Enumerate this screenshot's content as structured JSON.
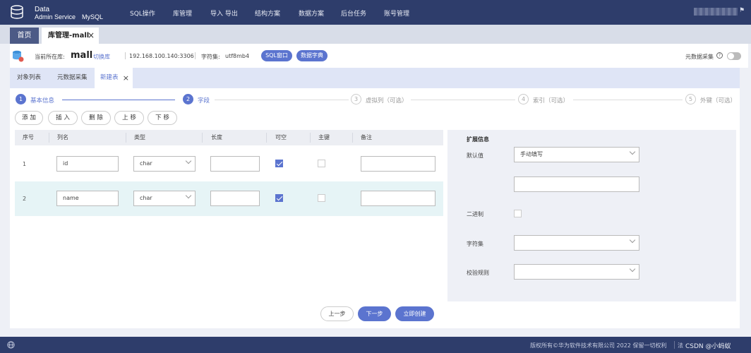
{
  "brand": {
    "line1": "Data",
    "line2": "Admin Service",
    "db": "MySQL"
  },
  "nav": [
    "SQL操作",
    "库管理",
    "导入 导出",
    "结构方案",
    "数据方案",
    "后台任务",
    "账号管理"
  ],
  "tabs": {
    "home": "首页",
    "current": "库管理-mall",
    "close": "×"
  },
  "db_bar": {
    "current_label": "当前所在库:",
    "db_name": "mall",
    "switch": "切换库",
    "host": "192.168.100.140:3306",
    "charset_label": "字符集:",
    "charset": "utf8mb4",
    "sql_window": "SQL窗口",
    "dictionary": "数据字典",
    "metadata_collect": "元数据采集",
    "metadata_enabled": false
  },
  "sub_tabs": [
    "对象列表",
    "元数据采集",
    "新建表"
  ],
  "sub_tab_close": "×",
  "steps": [
    {
      "num": "1",
      "label": "基本信息",
      "active": true
    },
    {
      "num": "2",
      "label": "字段",
      "active": true
    },
    {
      "num": "3",
      "label": "虚拟列（可选）",
      "active": false
    },
    {
      "num": "4",
      "label": "索引（可选）",
      "active": false
    },
    {
      "num": "5",
      "label": "外键（可选）",
      "active": false
    }
  ],
  "actions": [
    "添 加",
    "插 入",
    "删 除",
    "上 移",
    "下 移"
  ],
  "columns": [
    "序号",
    "列名",
    "类型",
    "长度",
    "可空",
    "主键",
    "备注"
  ],
  "rows": [
    {
      "index": "1",
      "name": "id",
      "type": "char",
      "length": "",
      "nullable": true,
      "primary": false,
      "comment": ""
    },
    {
      "index": "2",
      "name": "name",
      "type": "char",
      "length": "",
      "nullable": true,
      "primary": false,
      "comment": ""
    }
  ],
  "extension": {
    "title": "扩展信息",
    "default_label": "默认值",
    "default_value": "手动填写",
    "default_input": "",
    "binary_label": "二进制",
    "charset_label": "字符集",
    "charset_value": "",
    "collation_label": "校验规则",
    "collation_value": ""
  },
  "footer_buttons": {
    "prev": "上一步",
    "next": "下一步",
    "create": "立即创建"
  },
  "footer": {
    "copyright": "版权所有©华为软件技术有限公司 2022 保留一切权利",
    "law": "法",
    "watermark": "CSDN @小蚂蚁"
  },
  "colors": {
    "topbar": "#2e3d6b",
    "accent": "#5b74cf",
    "highlight_row": "#e6f4f6"
  }
}
